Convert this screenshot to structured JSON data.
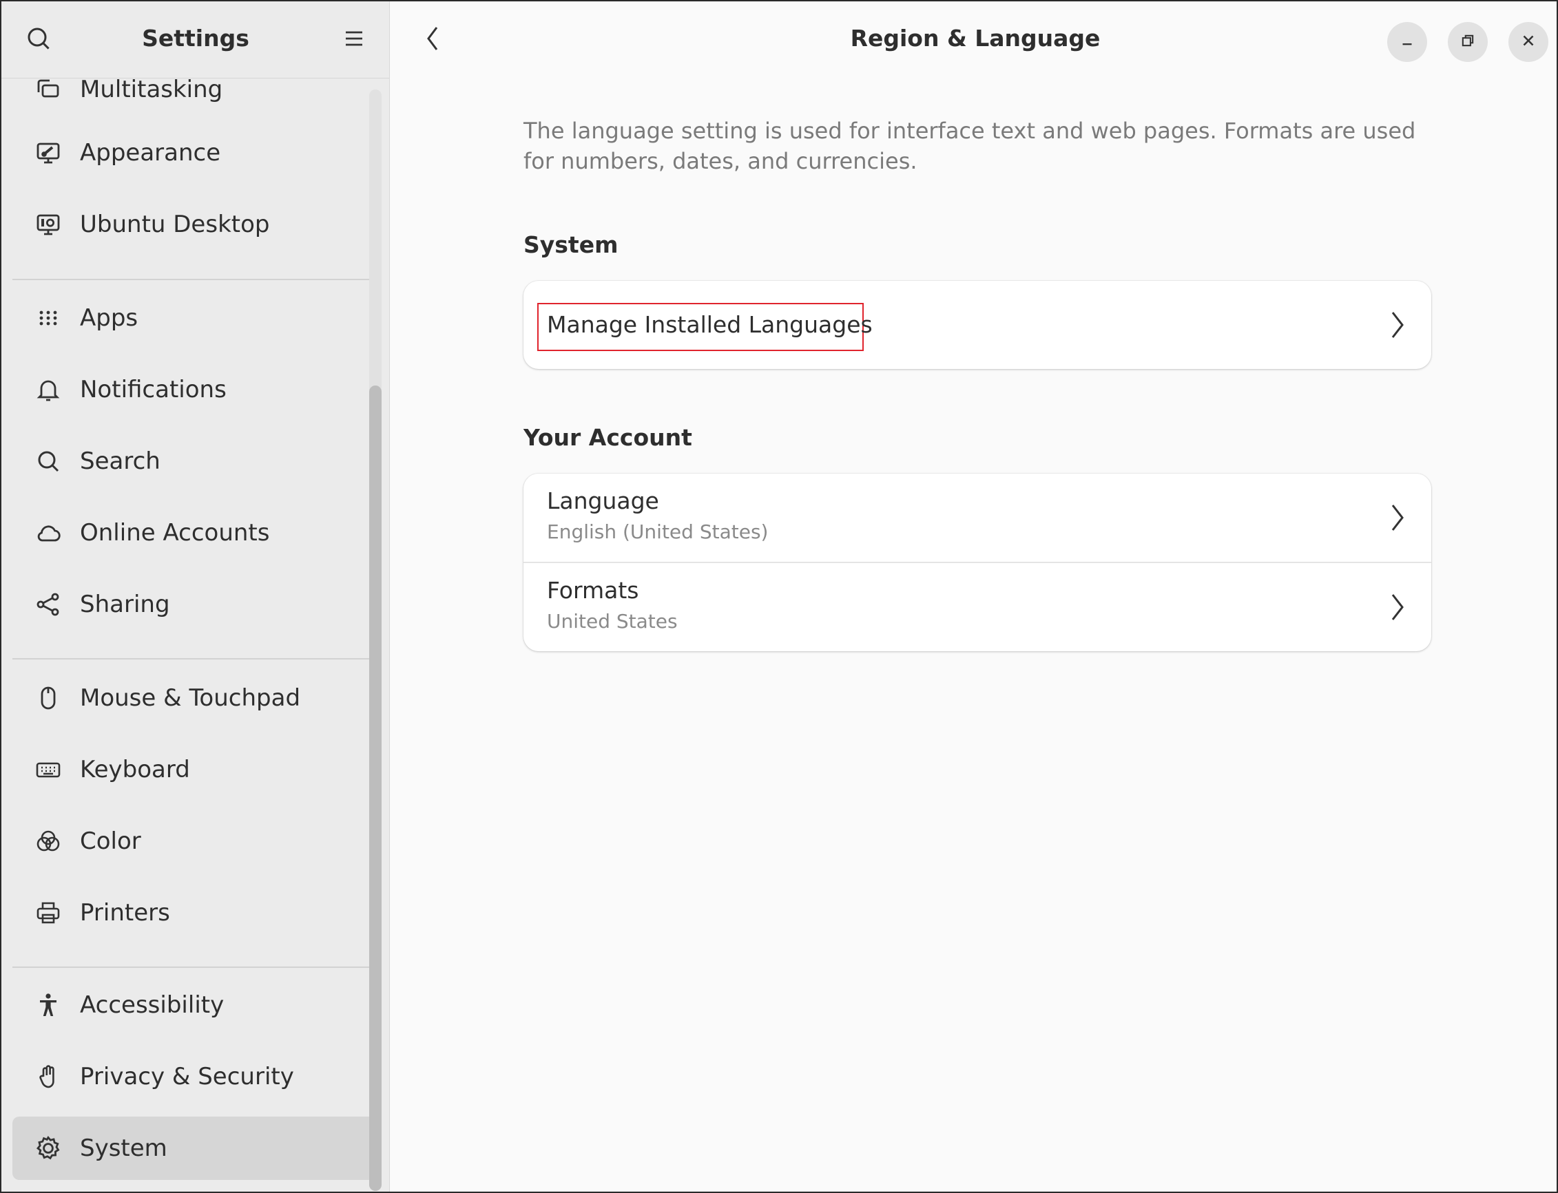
{
  "sidebar": {
    "title": "Settings",
    "items": [
      {
        "label": "Multitasking",
        "icon": "multitasking-icon"
      },
      {
        "label": "Appearance",
        "icon": "appearance-icon"
      },
      {
        "label": "Ubuntu Desktop",
        "icon": "ubuntu-desktop-icon"
      },
      {
        "label": "Apps",
        "icon": "apps-grid-icon"
      },
      {
        "label": "Notifications",
        "icon": "bell-icon"
      },
      {
        "label": "Search",
        "icon": "search-icon"
      },
      {
        "label": "Online Accounts",
        "icon": "cloud-icon"
      },
      {
        "label": "Sharing",
        "icon": "share-icon"
      },
      {
        "label": "Mouse & Touchpad",
        "icon": "mouse-icon"
      },
      {
        "label": "Keyboard",
        "icon": "keyboard-icon"
      },
      {
        "label": "Color",
        "icon": "color-icon"
      },
      {
        "label": "Printers",
        "icon": "printer-icon"
      },
      {
        "label": "Accessibility",
        "icon": "accessibility-icon"
      },
      {
        "label": "Privacy & Security",
        "icon": "hand-icon"
      },
      {
        "label": "System",
        "icon": "gear-icon",
        "selected": true
      }
    ]
  },
  "main": {
    "title": "Region & Language",
    "description": "The language setting is used for interface text and web pages. Formats are used for numbers, dates, and currencies.",
    "system_section": {
      "title": "System",
      "rows": [
        {
          "label": "Manage Installed Languages"
        }
      ]
    },
    "account_section": {
      "title": "Your Account",
      "rows": [
        {
          "label": "Language",
          "value": "English (United States)"
        },
        {
          "label": "Formats",
          "value": "United States"
        }
      ]
    }
  },
  "colors": {
    "highlight": "#e0242d",
    "sidebar_bg": "#ebebeb",
    "selected_bg": "#d6d6d6"
  }
}
